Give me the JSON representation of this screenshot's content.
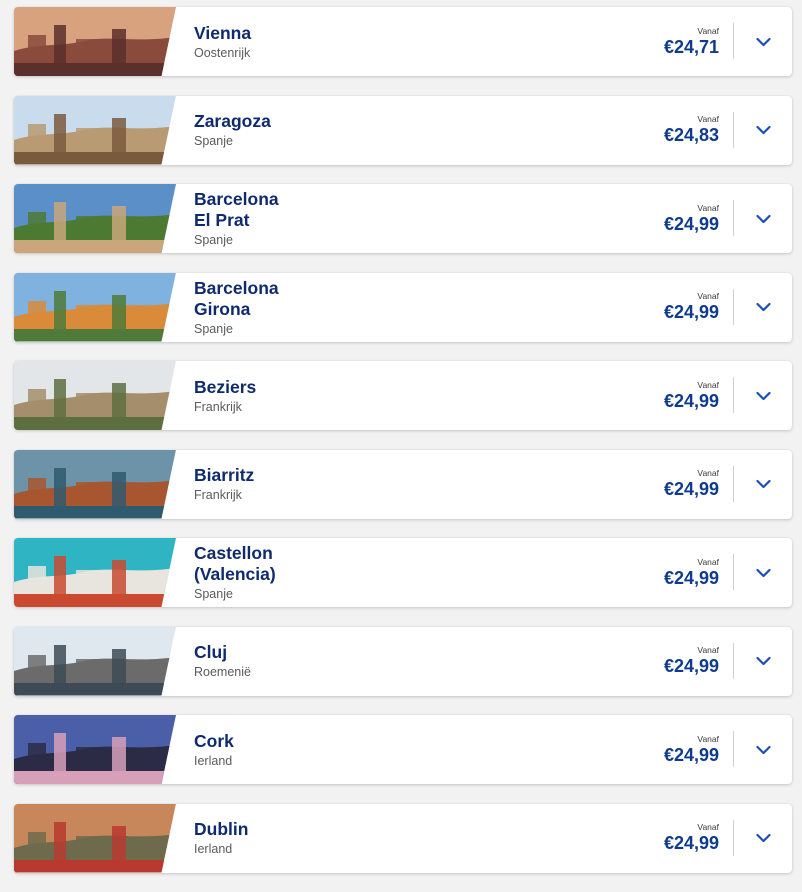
{
  "colors": {
    "city_text": "#0f2b6e",
    "price_text": "#0f3b8f",
    "chevron": "#1a4fb5",
    "page_background": "#f2f2f2"
  },
  "destinations": [
    {
      "city": "Vienna",
      "country": "Oostenrijk",
      "from_label": "Vanaf",
      "price": "€24,71",
      "image": "vienna-city-photo",
      "sky": "#d9a27e",
      "ground": "#8a4b3c",
      "accent": "#5a2f2c"
    },
    {
      "city": "Zaragoza",
      "country": "Spanje",
      "from_label": "Vanaf",
      "price": "€24,83",
      "image": "zaragoza-basilica-photo",
      "sky": "#c9dced",
      "ground": "#b89a73",
      "accent": "#7a5a3d"
    },
    {
      "city": "Barcelona\nEl Prat",
      "country": "Spanje",
      "from_label": "Vanaf",
      "price": "€24,99",
      "image": "barcelona-park-guell-photo",
      "sky": "#5b8fc7",
      "ground": "#4d7a32",
      "accent": "#c9a77a"
    },
    {
      "city": "Barcelona\nGirona",
      "country": "Spanje",
      "from_label": "Vanaf",
      "price": "€24,99",
      "image": "girona-colorful-houses-photo",
      "sky": "#7fb2df",
      "ground": "#d98b3a",
      "accent": "#4f7a3a"
    },
    {
      "city": "Beziers",
      "country": "Frankrijk",
      "from_label": "Vanaf",
      "price": "€24,99",
      "image": "beziers-cathedral-photo",
      "sky": "#e2e6e8",
      "ground": "#a58e6b",
      "accent": "#5d6e3f"
    },
    {
      "city": "Biarritz",
      "country": "Frankrijk",
      "from_label": "Vanaf",
      "price": "€24,99",
      "image": "biarritz-coast-photo",
      "sky": "#6c93a8",
      "ground": "#a8562f",
      "accent": "#2f5b6e"
    },
    {
      "city": "Castellon\n(Valencia)",
      "country": "Spanje",
      "from_label": "Vanaf",
      "price": "€24,99",
      "image": "castellon-harbour-photo",
      "sky": "#2fb4c4",
      "ground": "#e8e4de",
      "accent": "#c94a30"
    },
    {
      "city": "Cluj",
      "country": "Roemenië",
      "from_label": "Vanaf",
      "price": "€24,99",
      "image": "cluj-building-photo",
      "sky": "#dfe8ee",
      "ground": "#6b6b6b",
      "accent": "#3e4a55"
    },
    {
      "city": "Cork",
      "country": "Ierland",
      "from_label": "Vanaf",
      "price": "€24,99",
      "image": "cork-cathedral-photo",
      "sky": "#4b5fa8",
      "ground": "#2b2b45",
      "accent": "#d7a0b8"
    },
    {
      "city": "Dublin",
      "country": "Ierland",
      "from_label": "Vanaf",
      "price": "€24,99",
      "image": "dublin-bridge-photo",
      "sky": "#c7875a",
      "ground": "#6d6b4b",
      "accent": "#b83a2f"
    }
  ],
  "icons": {
    "expand": "chevron-down-icon"
  }
}
